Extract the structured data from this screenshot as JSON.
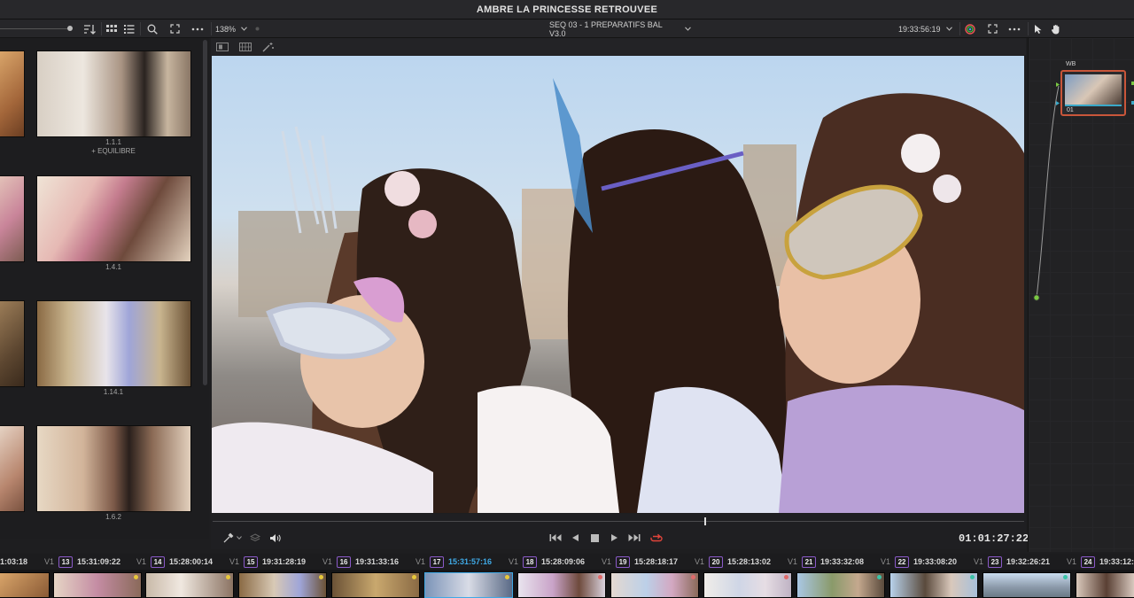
{
  "window": {
    "title": "AMBRE LA PRINCESSE RETROUVEE"
  },
  "toolbar": {
    "zoom": "138%",
    "sequence": "SEQ 03 - 1 PREPARATIFS BAL V3.0",
    "timecode": "19:33:56:19"
  },
  "media": {
    "clips": [
      {
        "label": "1.1.1",
        "sublabel": "+ EQUILIBRE"
      },
      {
        "label": "1.4.1",
        "sublabel": ""
      },
      {
        "label": "1.14.1",
        "sublabel": ""
      },
      {
        "label": "1.6.2",
        "sublabel": ""
      }
    ]
  },
  "transport": {
    "timecode": "01:01:27:22"
  },
  "nodes": {
    "node_label": "WB",
    "node_number": "01"
  },
  "timeline": {
    "first_time": "1:03:18",
    "track_label": "V1",
    "clips": [
      {
        "num": "13",
        "time": "15:31:09:22",
        "active": false
      },
      {
        "num": "14",
        "time": "15:28:00:14",
        "active": false
      },
      {
        "num": "15",
        "time": "19:31:28:19",
        "active": false
      },
      {
        "num": "16",
        "time": "19:31:33:16",
        "active": false
      },
      {
        "num": "17",
        "time": "15:31:57:16",
        "active": true
      },
      {
        "num": "18",
        "time": "15:28:09:06",
        "active": false
      },
      {
        "num": "19",
        "time": "15:28:18:17",
        "active": false
      },
      {
        "num": "20",
        "time": "15:28:13:02",
        "active": false
      },
      {
        "num": "21",
        "time": "19:33:32:08",
        "active": false
      },
      {
        "num": "22",
        "time": "19:33:08:20",
        "active": false
      },
      {
        "num": "23",
        "time": "19:32:26:21",
        "active": false
      },
      {
        "num": "24",
        "time": "19:33:12:",
        "active": false
      }
    ]
  },
  "colors": {
    "accent_blue": "#3fa9e6",
    "node_border": "#c9563a",
    "loop_red": "#e0443a",
    "clip_num_border": "#8a5ac8"
  }
}
